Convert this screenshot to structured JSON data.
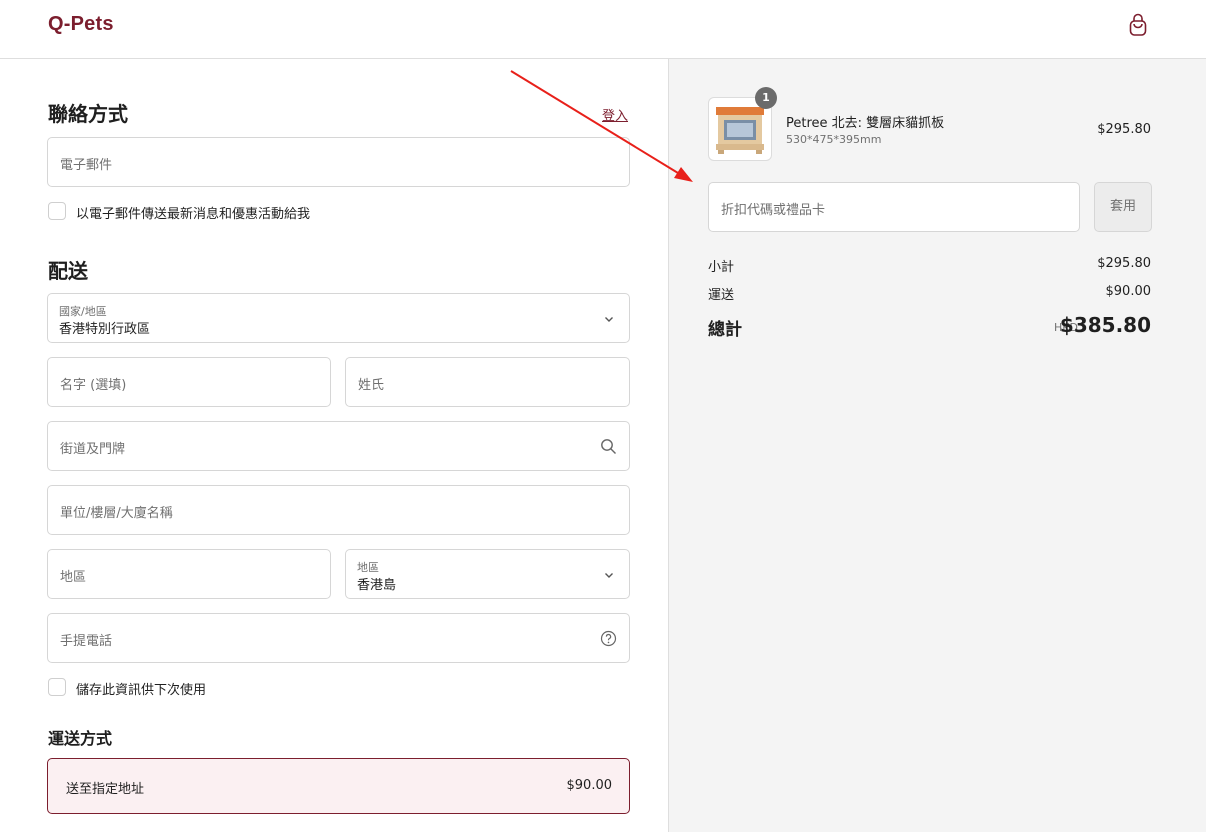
{
  "header": {
    "logo": "Q-Pets",
    "cart_icon": "shopping-bag-icon"
  },
  "contact": {
    "title": "聯絡方式",
    "login_link": "登入",
    "email_placeholder": "電子郵件",
    "newsletter_label": "以電子郵件傳送最新消息和優惠活動給我"
  },
  "delivery": {
    "title": "配送",
    "country_label": "國家/地區",
    "country_value": "香港特別行政區",
    "first_name_placeholder": "名字 (選填)",
    "last_name_placeholder": "姓氏",
    "address_placeholder": "街道及門牌",
    "apartment_placeholder": "單位/樓層/大廈名稱",
    "city_placeholder": "地區",
    "region_label": "地區",
    "region_value": "香港島",
    "phone_placeholder": "手提電話",
    "save_info_label": "儲存此資訊供下次使用"
  },
  "shipping_method": {
    "title": "運送方式",
    "option_name": "送至指定地址",
    "option_price": "$90.00"
  },
  "order": {
    "product": {
      "name": "Petree 北去: 雙層床貓抓板",
      "variant": "530*475*395mm",
      "price": "$295.80",
      "quantity": "1"
    },
    "discount_placeholder": "折扣代碼或禮品卡",
    "apply_label": "套用",
    "subtotal_label": "小計",
    "subtotal_value": "$295.80",
    "shipping_label": "運送",
    "shipping_value": "$90.00",
    "total_label": "總計",
    "total_currency": "HKD",
    "total_value": "$385.80"
  },
  "colors": {
    "brand": "#7c1e2e",
    "annotation_arrow": "#e8201a"
  }
}
